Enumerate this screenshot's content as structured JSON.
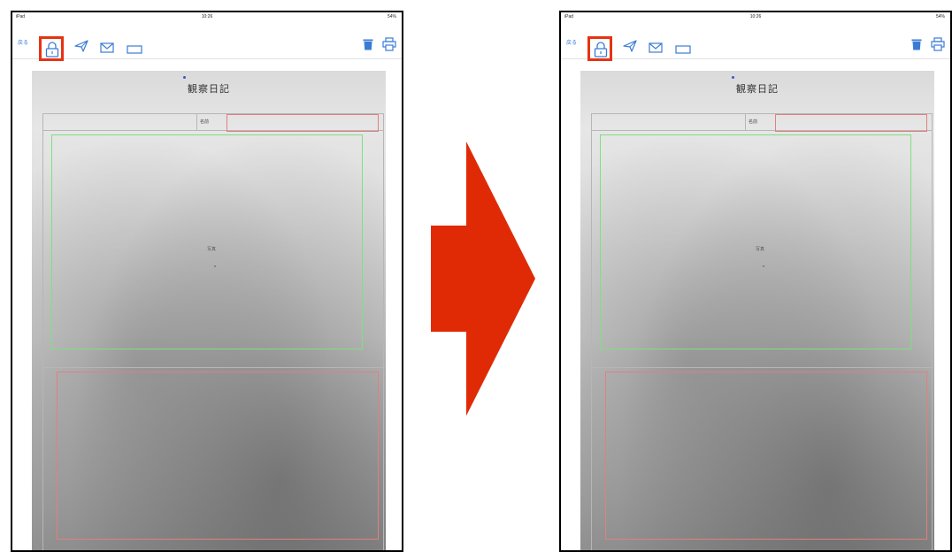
{
  "colors": {
    "toolbar_tint": "#3a7bd5",
    "highlight": "#e63312",
    "arrow": "#e02a06",
    "name_field_border": "#e08080",
    "photo_field_border": "#7ee07e"
  },
  "arrow": {
    "icon": "right-arrow",
    "direction": "right"
  },
  "screens": [
    {
      "status": {
        "carrier": "iPad",
        "time": "10:26",
        "battery": "54%"
      },
      "toolbar": {
        "back_label": "戻る",
        "icons": [
          "lock-icon",
          "send-icon",
          "mail-icon",
          "rectangle-icon",
          "trash-icon",
          "print-icon"
        ],
        "highlighted": "lock-icon"
      },
      "sheet": {
        "title": "観察日記",
        "name_label": "名前",
        "photo_label": "写真"
      }
    },
    {
      "status": {
        "carrier": "iPad",
        "time": "10:26",
        "battery": "54%"
      },
      "toolbar": {
        "back_label": "戻る",
        "icons": [
          "lock-icon",
          "send-icon",
          "mail-icon",
          "rectangle-icon",
          "trash-icon",
          "print-icon"
        ],
        "highlighted": "lock-icon"
      },
      "sheet": {
        "title": "観察日記",
        "name_label": "名前",
        "photo_label": "写真"
      }
    }
  ]
}
